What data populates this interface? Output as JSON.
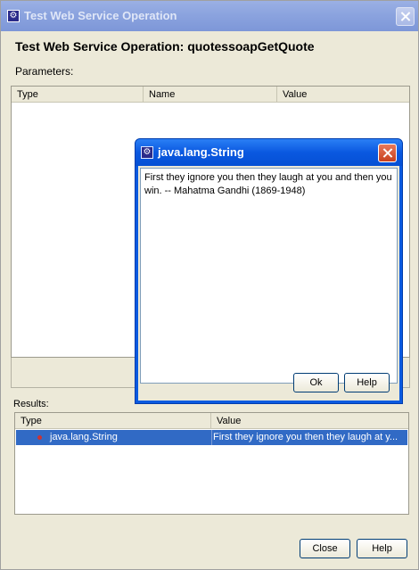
{
  "window": {
    "title": "Test Web Service Operation",
    "heading": "Test Web Service Operation: quotessoapGetQuote"
  },
  "parameters": {
    "label": "Parameters:",
    "columns": [
      "Type",
      "Name",
      "Value"
    ]
  },
  "results": {
    "label": "Results:",
    "columns": [
      "Type",
      "Value"
    ],
    "rows": [
      {
        "type": "java.lang.String",
        "value": "First they ignore you then they laugh at y..."
      }
    ]
  },
  "footer": {
    "close_label": "Close",
    "help_label": "Help"
  },
  "dialog": {
    "title": "java.lang.String",
    "text": "First they ignore you then they laugh at you and then you win. -- Mahatma Gandhi (1869-1948)",
    "ok_label": "Ok",
    "help_label": "Help"
  },
  "colors": {
    "selection": "#316ac5",
    "dialog_title": "#0a58e0",
    "window_bg": "#ece9d8"
  }
}
